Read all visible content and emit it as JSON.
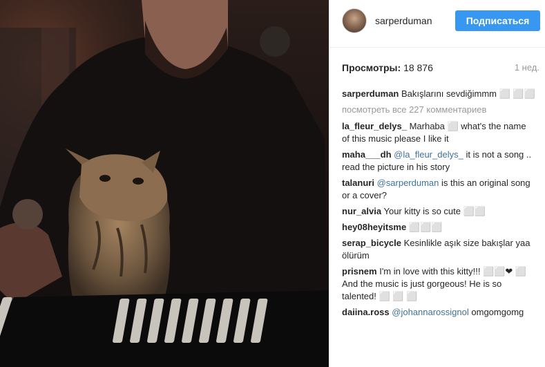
{
  "post": {
    "username": "sarperduman",
    "follow_label": "Подписаться",
    "views_label": "Просмотры:",
    "views_count": "18 876",
    "time_ago": "1 нед.",
    "caption": "Bakışlarını sevdiğimmm",
    "view_all": "посмотреть все 227 комментариев"
  },
  "comments": [
    {
      "user": "la_fleur_delys_",
      "mention": "",
      "text": "Marhaba ⬜ what's the name of this music please I like it"
    },
    {
      "user": "maha___dh",
      "mention": "@la_fleur_delys_",
      "text": "it is not a song .. read the picture in his story"
    },
    {
      "user": "talanuri",
      "mention": "@sarperduman",
      "text": "is this an original song or a cover?"
    },
    {
      "user": "nur_alvia",
      "mention": "",
      "text": "Your kitty is so cute ⬜⬜"
    },
    {
      "user": "hey08heyitsme",
      "mention": "",
      "text": "⬜⬜⬜"
    },
    {
      "user": "serap_bicycle",
      "mention": "",
      "text": "Kesinlikle aşık size bakışlar yaa ölürüm"
    },
    {
      "user": "prisnem",
      "mention": "",
      "text": "I'm in love with this kitty!!! ⬜⬜❤ ⬜ And the music is just gorgeous! He is so talented! ⬜ ⬜ ⬜"
    },
    {
      "user": "daiina.ross",
      "mention": "@johannarossignol",
      "text": "omgomgomg"
    }
  ]
}
